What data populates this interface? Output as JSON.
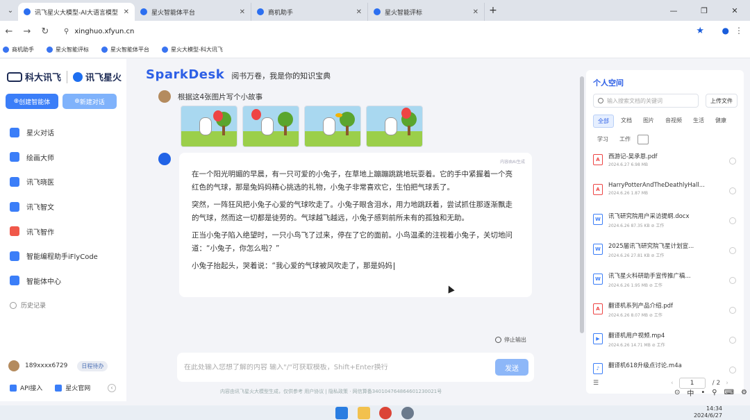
{
  "browser": {
    "tabs": [
      {
        "title": "讯飞星火大模型-AI大语言模型",
        "active": true
      },
      {
        "title": "星火智能体平台",
        "active": false
      },
      {
        "title": "商机助手",
        "active": false
      },
      {
        "title": "星火智能评标",
        "active": false
      }
    ],
    "url": "xinghuo.xfyun.cn",
    "bookmarks": [
      "商机助手",
      "星火智能评标",
      "星火智能体平台",
      "星火大模型-科大讯飞"
    ]
  },
  "sidebar": {
    "brand1": "科大讯飞",
    "brand2": "讯飞星火",
    "create_agent": "创建智能体",
    "new_chat": "新建对话",
    "items": [
      {
        "label": "星火对话",
        "color": "#3b7ef8"
      },
      {
        "label": "绘画大师",
        "color": "#3b7ef8"
      },
      {
        "label": "讯飞晓医",
        "color": "#3b7ef8"
      },
      {
        "label": "讯飞智文",
        "color": "#3b7ef8"
      },
      {
        "label": "讯飞智作",
        "color": "#f0584a"
      },
      {
        "label": "智能编程助手iFlyCode",
        "color": "#3b7ef8"
      },
      {
        "label": "智能体中心",
        "color": "#3b7ef8"
      }
    ],
    "history": "历史记录",
    "user": "189xxxx6729",
    "user_badge": "日程待办",
    "api": "API接入",
    "official": "星火官网"
  },
  "main": {
    "brand": "SparkDesk",
    "slogan": "阅书万卷，我是你的知识宝典",
    "question": "根据这4张图片写个小故事",
    "answer_tag": "内容由AI生成",
    "paragraphs": [
      "在一个阳光明媚的早晨，有一只可爱的小兔子，在草地上蹦蹦跳跳地玩耍着。它的手中紧握着一个亮红色的气球，那是兔妈妈精心挑选的礼物，小兔子非常喜欢它，生怕把气球丢了。",
      "突然，一阵狂风把小兔子心爱的气球吹走了。小兔子眼含泪水，用力地跳跃着，尝试抓住那逐渐飘走的气球，然而这一切都是徒劳的。气球越飞越远，小兔子感到前所未有的孤独和无助。",
      "正当小兔子陷入绝望时，一只小鸟飞了过来，停在了它的面前。小鸟温柔的注视着小兔子，关切地问道：“小兔子，你怎么啦？”",
      "小兔子抬起头，哭着说：“我心爱的气球被风吹走了，那是妈妈"
    ],
    "stop": "停止输出",
    "input_placeholder": "在此处输入您想了解的内容 输入\"/\"可获取模板，Shift+Enter换行",
    "send": "发送",
    "footer": "内容由讯飞星火大模型生成，仅供参考     用户协议  |  隐私政策 · 网信算备340104764864601230021号"
  },
  "panel": {
    "title": "个人空间",
    "search_placeholder": "输入搜索文档的关键词",
    "upload": "上传文件",
    "filters": [
      "全部",
      "文档",
      "图片",
      "音视频",
      "生活",
      "健康",
      "学习",
      "工作"
    ],
    "files": [
      {
        "name": "西游记-吴承恩.pdf",
        "meta": "2024.6.27  6.98 MB",
        "type": "pdf"
      },
      {
        "name": "HarryPotterAndTheDeathlyHall...",
        "meta": "2024.6.26  1.87 MB",
        "type": "pdf"
      },
      {
        "name": "讯飞研究院用户采访提纲.docx",
        "meta": "2024.6.26  87.35 KB  ⊘ 工作",
        "type": "doc"
      },
      {
        "name": "2025届讯飞研究院飞星计划宣...",
        "meta": "2024.6.26  27.81 KB  ⊘ 工作",
        "type": "doc"
      },
      {
        "name": "讯飞星火科研助手宣传推广稿...",
        "meta": "2024.6.26  1.95 MB  ⊘ 工作",
        "type": "doc"
      },
      {
        "name": "翻译机系列产品介绍.pdf",
        "meta": "2024.6.26  8.07 MB  ⊘ 工作",
        "type": "pdf"
      },
      {
        "name": "翻译机用户视频.mp4",
        "meta": "2024.6.26  14.71 MB  ⊘ 工作",
        "type": "vid"
      },
      {
        "name": "翻译机618升级点讨论.m4a",
        "meta": "",
        "type": "vid"
      }
    ],
    "page": "1",
    "total": "/ 2"
  },
  "taskbar": {
    "time": "14:34",
    "date": "2024/6/27",
    "lang": "中"
  }
}
